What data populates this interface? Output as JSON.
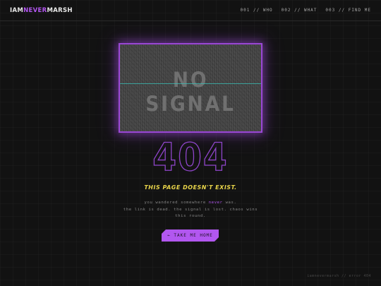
{
  "header": {
    "logo_prefix": "IAM",
    "logo_accent": "NEVER",
    "logo_suffix": "MARSH",
    "nav": [
      {
        "label": "001 // WHO"
      },
      {
        "label": "002 // WHAT"
      },
      {
        "label": "003 // FIND ME"
      }
    ]
  },
  "screen": {
    "text": "NO SIGNAL"
  },
  "error": {
    "code": "404",
    "tagline": "THIS PAGE DOESN'T EXIST.",
    "desc_pre": "you wandered somewhere ",
    "desc_highlight": "never",
    "desc_post": " was.",
    "desc_line2": "the link is dead. the signal is lost. chaos wins this round.",
    "button_label": "← TAKE ME HOME"
  },
  "footer": {
    "text": "iamnevermarsh // error 404"
  },
  "colors": {
    "accent": "#b257f0",
    "tagline": "#e8d44a",
    "background": "#121212",
    "scanline": "#3fb8b0"
  }
}
